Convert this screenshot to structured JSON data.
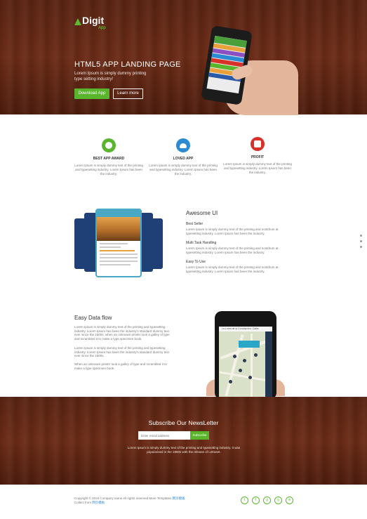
{
  "hero": {
    "logo_name": "Digit",
    "logo_sub": "App",
    "title": "HTML5 APP LANDING PAGE",
    "subtitle": "Lorem Ipsum is simply dummy printing type setting industry!",
    "download_label": "Download App",
    "learn_label": "Learn more"
  },
  "features": [
    {
      "icon": "chat-bubble-icon",
      "color": "#59b52b",
      "title": "BEST APP AWARD",
      "text": "Lorem Ipsum is simply dummy text of the printing and typesetting industry. Lorem Ipsum has been the industry."
    },
    {
      "icon": "cloud-icon",
      "color": "#2a8ad4",
      "title": "LOVED APP",
      "text": "Lorem Ipsum is simply dummy text of the printing and typesetting industry. Lorem Ipsum has been the industry."
    },
    {
      "icon": "gift-icon",
      "color": "#d8312a",
      "title": "PROFIT",
      "text": "Lorem Ipsum is simply dummy text of the printing and typesetting industry. Lorem Ipsum has been the industry."
    }
  ],
  "awesome": {
    "heading": "Awesome UI",
    "items": [
      {
        "title": "Best Seller",
        "text": "Lorem Ipsum is simply dummy text of the printing and nostdrum at typesetting industry. Lorem Ipsum has been the industry."
      },
      {
        "title": "Multi Task Handling",
        "text": "Lorem Ipsum is simply dummy text of the printing and nostdrum at typesetting industry. Lorem Ipsum has been the industry."
      },
      {
        "title": "Easy To Use",
        "text": "Lorem Ipsum is simply dummy text of the printing and nostdrum at typesetting industry. Lorem Ipsum has been the industry."
      }
    ]
  },
  "dataflow": {
    "heading": "Easy Data flow",
    "p1": "Lorem Ipsum is simply dummy text of the printing and typesetting industry. Lorem Ipsum has been the industry's standard dummy text ever since the 1500s, when an unknown printer took a galley of type and scrambled it to make a type specimen book.",
    "p2": "Lorem Ipsum is simply dummy text of the printing and typesetting industry. Lorem Ipsum has been the industry's standard dummy text ever since the 1500s.",
    "p3": "When an unknown printer took a galley of type and scrambled it to make a type specimen book.",
    "map_title": "La Línea de la Concepción, Cádiz"
  },
  "newsletter": {
    "title": "Subscribe Our NewsLetter",
    "placeholder": "Enter email address",
    "button": "Subscribe",
    "text": "Lorem Ipsum is simply dummy text of the printing and typesetting industry. It was popularised in the 1960s with the release of Letraset."
  },
  "footer": {
    "copyright": "Copyright © 2016 Company name All rights reserved",
    "template_label": "More Templates",
    "template_link": "网页模板",
    "collect_label": "Collect from",
    "collect_link": "网页模板"
  },
  "socials": [
    "twitter-icon",
    "facebook-icon",
    "google-plus-icon",
    "dribbble-icon",
    "linkedin-icon"
  ],
  "social_glyphs": [
    "t",
    "f",
    "g",
    "◎",
    "in"
  ]
}
